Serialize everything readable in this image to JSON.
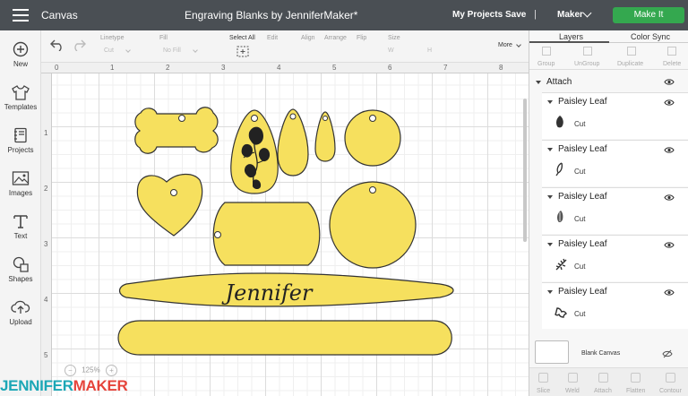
{
  "topbar": {
    "app_title": "Canvas",
    "project_title": "Engraving Blanks by JenniferMaker*",
    "my_projects": "My Projects",
    "save": "Save",
    "separator": "|",
    "machine": "Maker",
    "make_it": "Make It"
  },
  "left_tools": [
    {
      "label": "New",
      "icon": "plus-circle-icon"
    },
    {
      "label": "Templates",
      "icon": "shirt-icon"
    },
    {
      "label": "Projects",
      "icon": "notebook-icon"
    },
    {
      "label": "Images",
      "icon": "image-icon"
    },
    {
      "label": "Text",
      "icon": "text-icon"
    },
    {
      "label": "Shapes",
      "icon": "shapes-icon"
    },
    {
      "label": "Upload",
      "icon": "upload-icon"
    }
  ],
  "toolbar": {
    "linetype_label": "Linetype",
    "linetype_value": "Cut",
    "fill_label": "Fill",
    "fill_value": "No Fill",
    "select_all": "Select All",
    "edit": "Edit",
    "align": "Align",
    "arrange": "Arrange",
    "flip": "Flip",
    "size": "Size",
    "size_w": "W",
    "size_h": "H",
    "more": "More"
  },
  "rulers": {
    "top": [
      "0",
      "1",
      "2",
      "3",
      "4",
      "5",
      "6",
      "7",
      "8"
    ],
    "left": [
      "1",
      "2",
      "3",
      "4",
      "5"
    ]
  },
  "canvas": {
    "engraved_text": "Jennifer",
    "zoom_value": "125%",
    "zoom_minus": "−",
    "zoom_plus": "+",
    "fill_color": "#f6e05e",
    "stroke_color": "#333333"
  },
  "brand": {
    "part1": "JENNIFER",
    "part2": "MAKER"
  },
  "panel": {
    "tabs": [
      "Layers",
      "Color Sync"
    ],
    "actions": [
      "Group",
      "UnGroup",
      "Duplicate",
      "Delete"
    ],
    "group_name": "Attach",
    "layers": [
      {
        "name": "Paisley Leaf",
        "type": "Cut"
      },
      {
        "name": "Paisley Leaf",
        "type": "Cut"
      },
      {
        "name": "Paisley Leaf",
        "type": "Cut"
      },
      {
        "name": "Paisley Leaf",
        "type": "Cut"
      },
      {
        "name": "Paisley Leaf",
        "type": "Cut"
      }
    ],
    "blank_canvas": "Blank Canvas",
    "bottom_actions": [
      "Slice",
      "Weld",
      "Attach",
      "Flatten",
      "Contour"
    ]
  }
}
